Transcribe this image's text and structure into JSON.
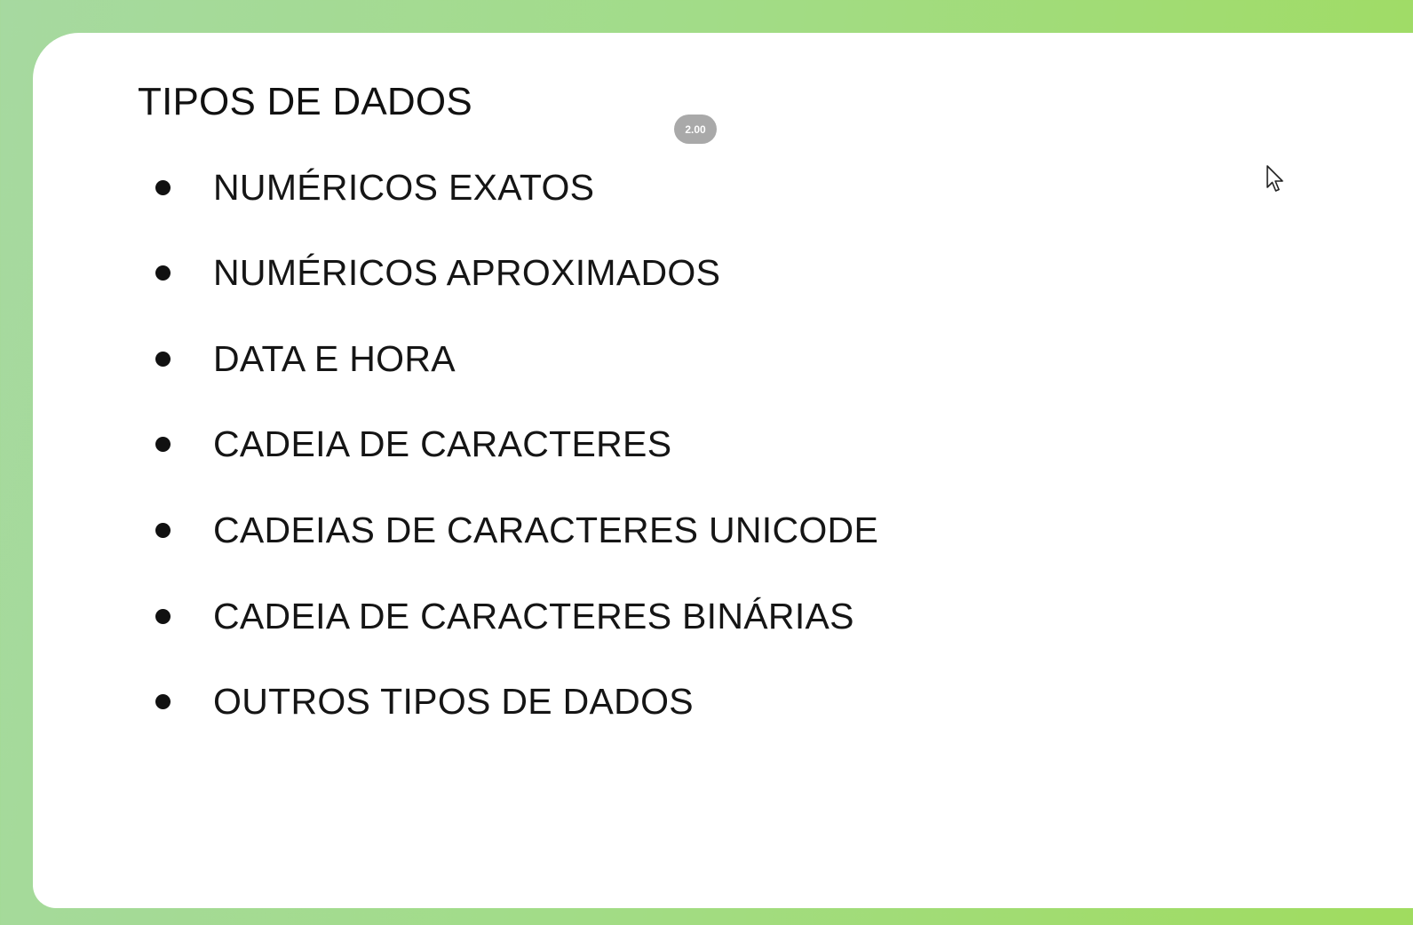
{
  "slide": {
    "title": "TIPOS DE DADOS",
    "items": [
      "NUMÉRICOS EXATOS",
      "NUMÉRICOS APROXIMADOS",
      "DATA E HORA",
      "CADEIA DE CARACTERES",
      "CADEIAS DE CARACTERES UNICODE",
      "CADEIA DE CARACTERES BINÁRIAS",
      "OUTROS TIPOS DE DADOS"
    ]
  },
  "player": {
    "speed_label": "2.00"
  },
  "icons": {
    "cursor": "mouse-pointer-icon",
    "bullet": "bullet-dot-icon"
  },
  "colors": {
    "background_left": "#a6d9a0",
    "background_right": "#a0dc5f",
    "slide": "#ffffff",
    "text": "#151515",
    "badge": "#a9a9a9"
  }
}
